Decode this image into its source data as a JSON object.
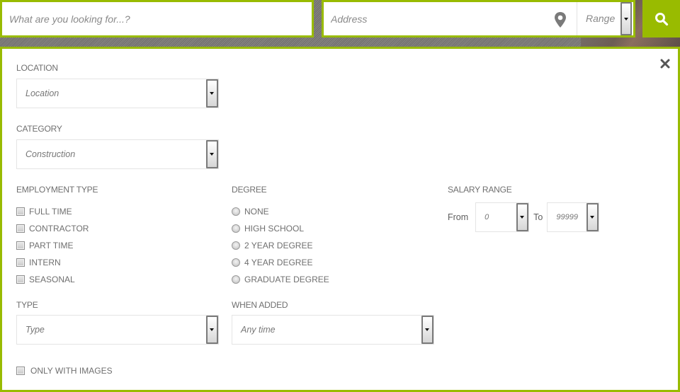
{
  "topbar": {
    "search_placeholder": "What are you looking for...?",
    "address_placeholder": "Address",
    "range_label": "Range",
    "icons": {
      "location": "map-pin-icon",
      "search": "search-icon"
    },
    "accent_color": "#99bb00"
  },
  "panel": {
    "close_icon": "close-icon",
    "location": {
      "label": "LOCATION",
      "value": "Location"
    },
    "category": {
      "label": "CATEGORY",
      "value": "Construction"
    },
    "employment_type": {
      "label": "EMPLOYMENT TYPE",
      "options": [
        "FULL TIME",
        "CONTRACTOR",
        "PART TIME",
        "INTERN",
        "SEASONAL"
      ]
    },
    "degree": {
      "label": "DEGREE",
      "options": [
        "NONE",
        "HIGH SCHOOL",
        "2 YEAR DEGREE",
        "4 YEAR DEGREE",
        "GRADUATE DEGREE"
      ]
    },
    "salary_range": {
      "label": "SALARY RANGE",
      "from_label": "From",
      "from_value": "0",
      "to_label": "To",
      "to_value": "99999"
    },
    "type": {
      "label": "TYPE",
      "value": "Type"
    },
    "when_added": {
      "label": "WHEN ADDED",
      "value": "Any time"
    },
    "only_with_images": "ONLY WITH IMAGES"
  }
}
